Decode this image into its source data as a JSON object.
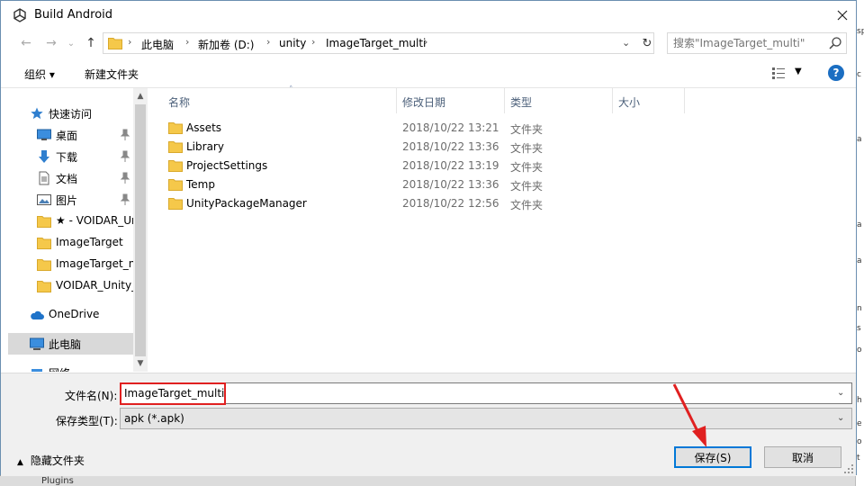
{
  "window": {
    "title": "Build Android"
  },
  "address": {
    "crumbs": [
      "此电脑",
      "新加卷 (D:)",
      "unity",
      "ImageTarget_multi"
    ]
  },
  "search": {
    "placeholder": "搜索\"ImageTarget_multi\""
  },
  "toolbar": {
    "organize": "组织 ▾",
    "new_folder": "新建文件夹"
  },
  "sidebar": {
    "items": [
      {
        "label": "快速访问",
        "icon": "star-icon"
      },
      {
        "label": "桌面",
        "icon": "desktop-icon",
        "pinned": true
      },
      {
        "label": "下载",
        "icon": "download-icon",
        "pinned": true
      },
      {
        "label": "文档",
        "icon": "document-icon",
        "pinned": true
      },
      {
        "label": "图片",
        "icon": "picture-icon",
        "pinned": true
      },
      {
        "label": "★ - VOIDAR_Ur",
        "icon": "folder-icon"
      },
      {
        "label": "ImageTarget",
        "icon": "folder-icon"
      },
      {
        "label": "ImageTarget_n",
        "icon": "folder-icon"
      },
      {
        "label": "VOIDAR_Unity_",
        "icon": "folder-icon"
      },
      {
        "label": "OneDrive",
        "icon": "cloud-icon"
      },
      {
        "label": "此电脑",
        "icon": "computer-icon",
        "selected": true
      },
      {
        "label": "网络",
        "icon": "network-icon"
      }
    ]
  },
  "columns": [
    "名称",
    "修改日期",
    "类型",
    "大小"
  ],
  "files": [
    {
      "name": "Assets",
      "date": "2018/10/22 13:21",
      "type": "文件夹"
    },
    {
      "name": "Library",
      "date": "2018/10/22 13:36",
      "type": "文件夹"
    },
    {
      "name": "ProjectSettings",
      "date": "2018/10/22 13:19",
      "type": "文件夹"
    },
    {
      "name": "Temp",
      "date": "2018/10/22 13:36",
      "type": "文件夹"
    },
    {
      "name": "UnityPackageManager",
      "date": "2018/10/22 12:56",
      "type": "文件夹"
    }
  ],
  "form": {
    "filename_label": "文件名(N):",
    "filename_value": "ImageTarget_multi",
    "filetype_label": "保存类型(T):",
    "filetype_value": "apk (*.apk)",
    "save_label": "保存(S)",
    "cancel_label": "取消",
    "hide_folders_label": "隐藏文件夹"
  },
  "background": {
    "bottom_text": "Plugins"
  },
  "colors": {
    "accent": "#0078d7",
    "highlight": "#e02020",
    "folder": "#f5c84a",
    "help": "#1b6ec2"
  }
}
